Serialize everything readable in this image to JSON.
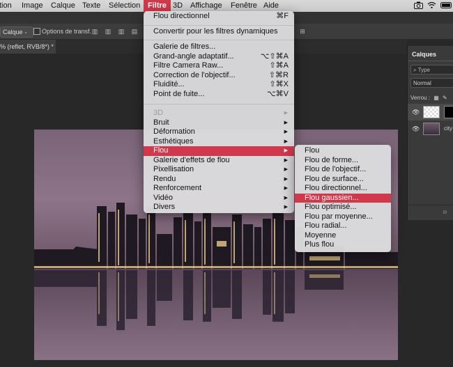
{
  "menubar": {
    "items": [
      "tion",
      "Image",
      "Calque",
      "Texte",
      "Sélection",
      "Filtre",
      "3D",
      "Affichage",
      "Fenêtre",
      "Aide"
    ],
    "active_index": 5
  },
  "options_bar": {
    "select_value": "Calque",
    "checkbox_label": "Options de transf."
  },
  "document_tab": {
    "title": "% (reflet, RVB/8*) *"
  },
  "layers_panel": {
    "title": "Calques",
    "search_placeholder": "Type",
    "blend_mode": "Normal",
    "lock_label": "Verrou :",
    "layers": [
      {
        "name": ""
      },
      {
        "name": "city"
      }
    ]
  },
  "filter_menu": {
    "items": [
      {
        "label": "Flou directionnel",
        "shortcut": "⌘F"
      },
      {
        "label": "Convertir pour les filtres dynamiques",
        "shortcut": ""
      },
      {
        "label": "Galerie de filtres...",
        "shortcut": ""
      },
      {
        "label": "Grand-angle adaptatif...",
        "shortcut": "⌥⇧⌘A"
      },
      {
        "label": "Filtre Camera Raw...",
        "shortcut": "⇧⌘A"
      },
      {
        "label": "Correction de l'objectif...",
        "shortcut": "⇧⌘R"
      },
      {
        "label": "Fluidité...",
        "shortcut": "⇧⌘X"
      },
      {
        "label": "Point de fuite...",
        "shortcut": "⌥⌘V"
      },
      {
        "label": "3D",
        "shortcut": ""
      },
      {
        "label": "Bruit",
        "shortcut": ""
      },
      {
        "label": "Déformation",
        "shortcut": ""
      },
      {
        "label": "Esthétiques",
        "shortcut": ""
      },
      {
        "label": "Flou",
        "shortcut": ""
      },
      {
        "label": "Galerie d'effets de flou",
        "shortcut": ""
      },
      {
        "label": "Pixellisation",
        "shortcut": ""
      },
      {
        "label": "Rendu",
        "shortcut": ""
      },
      {
        "label": "Renforcement",
        "shortcut": ""
      },
      {
        "label": "Vidéo",
        "shortcut": ""
      },
      {
        "label": "Divers",
        "shortcut": ""
      }
    ]
  },
  "blur_submenu": {
    "items": [
      "Flou",
      "Flou de forme...",
      "Flou de l'objectif...",
      "Flou de surface...",
      "Flou directionnel...",
      "Flou gaussien...",
      "Flou optimisé...",
      "Flou par moyenne...",
      "Flou radial...",
      "Moyenne",
      "Plus flou"
    ],
    "highlighted_index": 5
  },
  "colors": {
    "highlight": "#d0394b",
    "menu_bg": "#dcdcde",
    "app_bg": "#282828"
  }
}
